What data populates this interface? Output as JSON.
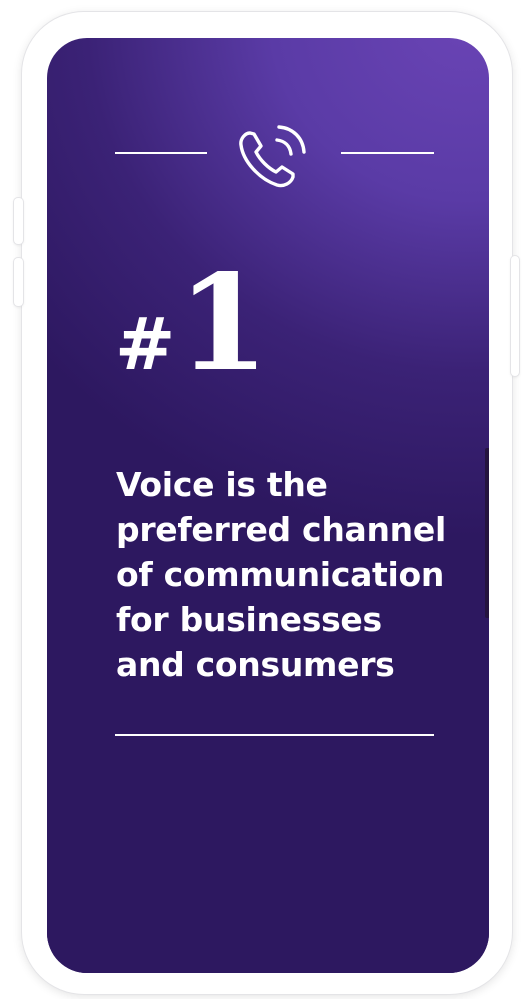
{
  "stat": {
    "hash": "#",
    "number": "1",
    "headline": "Voice is the\npreferred channel\nof communication\nfor businesses\nand consumers"
  },
  "icons": {
    "main": "phone-ringing-icon"
  },
  "colors": {
    "background_top": "#6a44b5",
    "background_bottom": "#2d1860",
    "text": "#ffffff",
    "device_frame": "#ffffff"
  }
}
